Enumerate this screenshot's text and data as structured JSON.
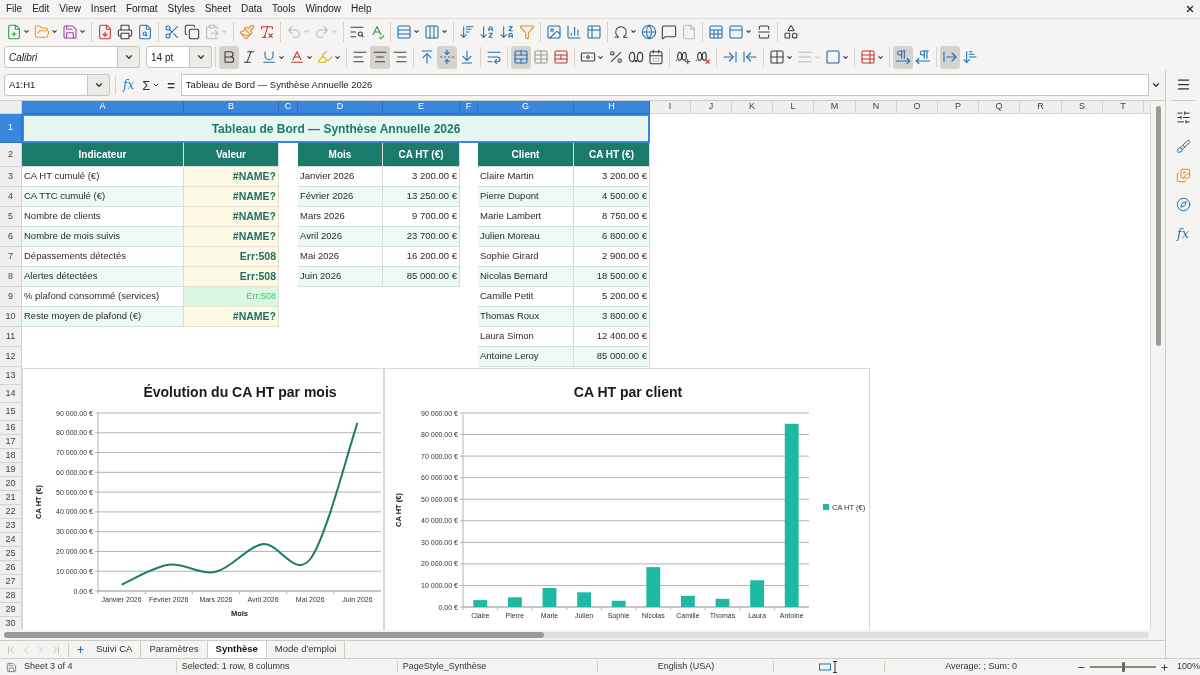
{
  "menu_bar": {
    "items": [
      "File",
      "Edit",
      "View",
      "Insert",
      "Format",
      "Styles",
      "Sheet",
      "Data",
      "Tools",
      "Window",
      "Help"
    ]
  },
  "standard_toolbar": {
    "paste_disabled": true,
    "undo_disabled": true,
    "redo_disabled": true,
    "headers_footers_disabled": true
  },
  "formatting_toolbar": {
    "font_name": "Calibri",
    "font_size": "14 pt",
    "bold": true,
    "italic": false,
    "underline": false,
    "align_left": false,
    "align_center": true,
    "align_right": false,
    "align_top": false,
    "align_middle": true,
    "align_bottom": false,
    "merge_and_center": true,
    "border_style_disabled": true,
    "left_to_right": true,
    "right_to_left": false,
    "text_horizontal": true,
    "text_vertical": false
  },
  "formula_bar": {
    "name_box": "A1:H1",
    "function_wizard": "fx",
    "sum": "Σ",
    "formula": "=",
    "content": "Tableau de Bord — Synthèse Annuelle 2026"
  },
  "sidebar": {
    "functions": "fx"
  },
  "columns": [
    {
      "label": "A",
      "selected": true
    },
    {
      "label": "B",
      "selected": true
    },
    {
      "label": "C",
      "selected": true
    },
    {
      "label": "D",
      "selected": true
    },
    {
      "label": "E",
      "selected": true
    },
    {
      "label": "F",
      "selected": true
    },
    {
      "label": "G",
      "selected": true
    },
    {
      "label": "H",
      "selected": true
    },
    {
      "label": "I",
      "selected": false
    },
    {
      "label": "J",
      "selected": false
    },
    {
      "label": "K",
      "selected": false
    },
    {
      "label": "L",
      "selected": false
    },
    {
      "label": "M",
      "selected": false
    },
    {
      "label": "N",
      "selected": false
    },
    {
      "label": "O",
      "selected": false
    },
    {
      "label": "P",
      "selected": false
    },
    {
      "label": "Q",
      "selected": false
    },
    {
      "label": "R",
      "selected": false
    },
    {
      "label": "S",
      "selected": false
    },
    {
      "label": "T",
      "selected": false
    }
  ],
  "rows": [
    {
      "label": "1",
      "selected": true
    },
    {
      "label": "2",
      "selected": false
    },
    {
      "label": "3",
      "selected": false
    },
    {
      "label": "4",
      "selected": false
    },
    {
      "label": "5",
      "selected": false
    },
    {
      "label": "6",
      "selected": false
    },
    {
      "label": "7",
      "selected": false
    },
    {
      "label": "8",
      "selected": false
    },
    {
      "label": "9",
      "selected": false
    },
    {
      "label": "10",
      "selected": false
    },
    {
      "label": "11",
      "selected": false
    },
    {
      "label": "12",
      "selected": false
    },
    {
      "label": "13",
      "selected": false
    },
    {
      "label": "14",
      "selected": false
    },
    {
      "label": "15",
      "selected": false
    },
    {
      "label": "16",
      "selected": false
    },
    {
      "label": "17",
      "selected": false
    },
    {
      "label": "18",
      "selected": false
    },
    {
      "label": "19",
      "selected": false
    },
    {
      "label": "20",
      "selected": false
    },
    {
      "label": "21",
      "selected": false
    },
    {
      "label": "22",
      "selected": false
    },
    {
      "label": "23",
      "selected": false
    },
    {
      "label": "24",
      "selected": false
    },
    {
      "label": "25",
      "selected": false
    },
    {
      "label": "26",
      "selected": false
    },
    {
      "label": "27",
      "selected": false
    },
    {
      "label": "28",
      "selected": false
    },
    {
      "label": "29",
      "selected": false
    },
    {
      "label": "30",
      "selected": false
    }
  ],
  "sheet": {
    "title": "Tableau de Bord — Synthèse Annuelle 2026",
    "indicators": {
      "headers": [
        "Indicateur",
        "Valeur"
      ],
      "rows": [
        {
          "label": "CA HT cumulé (€)",
          "value": "#NAME?",
          "highlighted": false
        },
        {
          "label": "CA TTC cumulé (€)",
          "value": "#NAME?",
          "highlighted": false
        },
        {
          "label": "Nombre de clients",
          "value": "#NAME?",
          "highlighted": false
        },
        {
          "label": "Nombre de mois suivis",
          "value": "#NAME?",
          "highlighted": false
        },
        {
          "label": "Dépassements détectés",
          "value": "Err:508",
          "highlighted": false
        },
        {
          "label": "Alertes détectées",
          "value": "Err:508",
          "highlighted": false
        },
        {
          "label": "% plafond consommé (services)",
          "value": "Err:508",
          "highlighted": true
        },
        {
          "label": "Reste moyen de plafond (€)",
          "value": "#NAME?",
          "highlighted": false
        }
      ]
    },
    "months": {
      "headers": [
        "Mois",
        "CA HT (€)"
      ],
      "rows": [
        {
          "month": "Janvier 2026",
          "amount": "3 200.00 €"
        },
        {
          "month": "Février 2026",
          "amount": "13 250.00 €"
        },
        {
          "month": "Mars 2026",
          "amount": "9 700.00 €"
        },
        {
          "month": "Avril 2026",
          "amount": "23 700.00 €"
        },
        {
          "month": "Mai 2026",
          "amount": "16 200.00 €"
        },
        {
          "month": "Juin 2026",
          "amount": "85 000.00 €"
        }
      ]
    },
    "clients": {
      "headers": [
        "Client",
        "CA HT (€)"
      ],
      "rows": [
        {
          "client": "Claire Martin",
          "amount": "3 200.00 €"
        },
        {
          "client": "Pierre Dupont",
          "amount": "4 500.00 €"
        },
        {
          "client": "Marie Lambert",
          "amount": "8 750.00 €"
        },
        {
          "client": "Julien Moreau",
          "amount": "6 800.00 €"
        },
        {
          "client": "Sophie Girard",
          "amount": "2 900.00 €"
        },
        {
          "client": "Nicolas Bernard",
          "amount": "18 500.00 €"
        },
        {
          "client": "Camille Petit",
          "amount": "5 200.00 €"
        },
        {
          "client": "Thomas Roux",
          "amount": "3 800.00 €"
        },
        {
          "client": "Laura Simon",
          "amount": "12 400.00 €"
        },
        {
          "client": "Antoine Leroy",
          "amount": "85 000.00 €"
        }
      ]
    }
  },
  "charts": [
    {
      "chart_data": {
        "type": "line",
        "title": "Évolution du CA HT par mois",
        "xlabel": "Mois",
        "ylabel": "CA HT (€)",
        "categories": [
          "Janvier 2026",
          "Février 2026",
          "Mars 2026",
          "Avril 2026",
          "Mai 2026",
          "Juin 2026"
        ],
        "series": [
          {
            "color": "#1e7b6d",
            "values": [
              3200,
              13300,
              9700,
              23700,
              16200,
              85000
            ]
          }
        ],
        "ylim": [
          0,
          90000
        ],
        "yticks": [
          {
            "value": 0,
            "label": "0.00 €"
          },
          {
            "value": 10000,
            "label": "10 000.00 €"
          },
          {
            "value": 20000,
            "label": "20 000.00 €"
          },
          {
            "value": 30000,
            "label": "30 000.00 €"
          },
          {
            "value": 40000,
            "label": "40 000.00 €"
          },
          {
            "value": 50000,
            "label": "50 000.00 €"
          },
          {
            "value": 60000,
            "label": "60 000.00 €"
          },
          {
            "value": 70000,
            "label": "70 000.00 €"
          },
          {
            "value": 80000,
            "label": "80 000.00 €"
          },
          {
            "value": 90000,
            "label": "90 000.00 €"
          }
        ],
        "grid": true
      }
    },
    {
      "chart_data": {
        "type": "bar",
        "title": "CA HT par client",
        "ylabel": "CA HT (€)",
        "categories": [
          "Claire",
          "Pierre",
          "Marie",
          "Julien",
          "Sophie",
          "Nicolas",
          "Camille",
          "Thomas",
          "Laura",
          "Antoine"
        ],
        "series": [
          {
            "name": "CA HT (€)",
            "color": "#1db9a2",
            "values": [
              3200,
              4500,
              8800,
              6800,
              2900,
              18500,
              5200,
              3800,
              12400,
              85000
            ]
          }
        ],
        "ylim": [
          0,
          90000
        ],
        "yticks": [
          {
            "value": 0,
            "label": "0.00 €"
          },
          {
            "value": 10000,
            "label": "10 000.00 €"
          },
          {
            "value": 20000,
            "label": "20 000.00 €"
          },
          {
            "value": 30000,
            "label": "30 000.00 €"
          },
          {
            "value": 40000,
            "label": "40 000.00 €"
          },
          {
            "value": 50000,
            "label": "50 000.00 €"
          },
          {
            "value": 60000,
            "label": "60 000.00 €"
          },
          {
            "value": 70000,
            "label": "70 000.00 €"
          },
          {
            "value": 80000,
            "label": "80 000.00 €"
          },
          {
            "value": 90000,
            "label": "90 000.00 €"
          }
        ],
        "grid": true
      }
    }
  ],
  "sheet_navigation": {
    "disabled": true
  },
  "sheet_tabs": [
    {
      "label": "Suivi CA",
      "selected": false
    },
    {
      "label": "Paramètres",
      "selected": false
    },
    {
      "label": "Synthèse",
      "selected": true
    },
    {
      "label": "Mode d'emploi",
      "selected": false
    }
  ],
  "status_bar": {
    "sheet": "Sheet 3 of 4",
    "selection": "Selected: 1 row, 8 columns",
    "page_style": "PageStyle_Synthèse",
    "language": "English (USA)",
    "summary": "Average: ; Sum: 0",
    "zoom_slider": {
      "level": 0.5
    },
    "zoom": "100%"
  }
}
